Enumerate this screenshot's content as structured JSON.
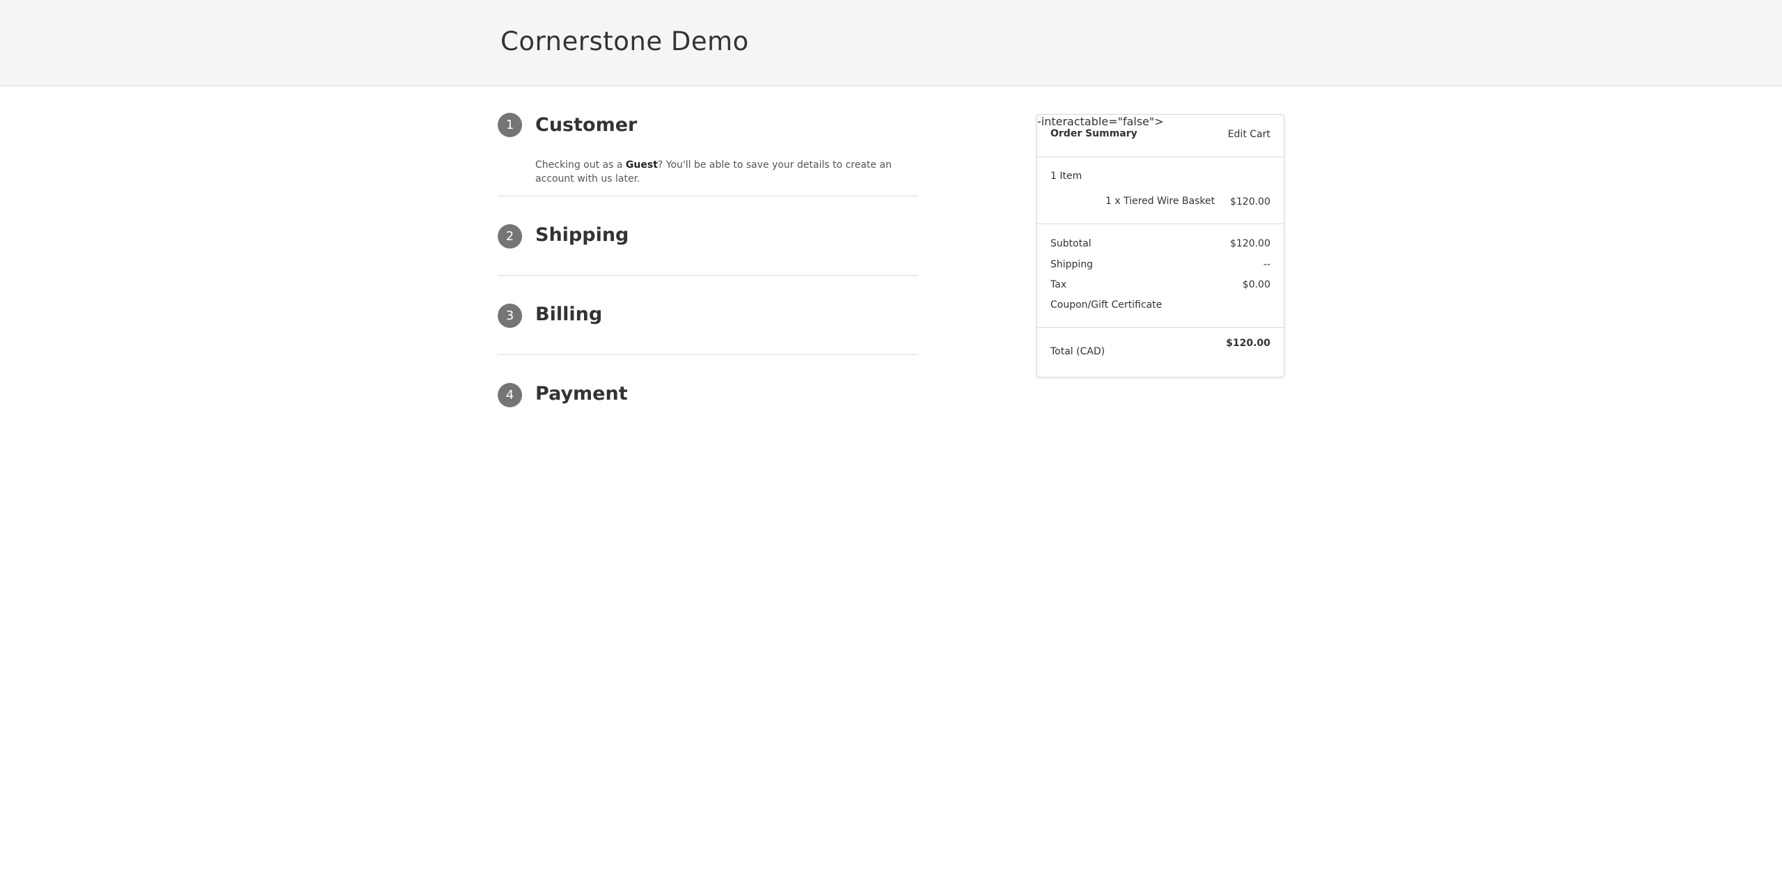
{
  "header": {
    "store_name": "Cornerstone Demo"
  },
  "steps": [
    {
      "number": "1",
      "title": "Customer",
      "body_prefix": "Checking out as a ",
      "body_bold": "Guest",
      "body_suffix": "? You'll be able to save your details to create an account with us later."
    },
    {
      "number": "2",
      "title": "Shipping"
    },
    {
      "number": "3",
      "title": "Billing"
    },
    {
      "number": "4",
      "title": "Payment"
    }
  ],
  "summary": {
    "title": "Order Summary",
    "edit_cart": "Edit Cart",
    "item_count": "1 Item",
    "items": [
      {
        "description": "1 x Tiered Wire Basket",
        "price": "$120.00"
      }
    ],
    "subtotal_label": "Subtotal",
    "subtotal_value": "$120.00",
    "shipping_label": "Shipping",
    "shipping_value": "--",
    "tax_label": "Tax",
    "tax_value": "$0.00",
    "coupon_link": "Coupon/Gift Certificate",
    "total_label": "Total (CAD)",
    "total_value": "$120.00"
  },
  "colors": {
    "link": "#4361ee",
    "step_badge": "#757575",
    "header_bg": "#f5f5f5"
  }
}
